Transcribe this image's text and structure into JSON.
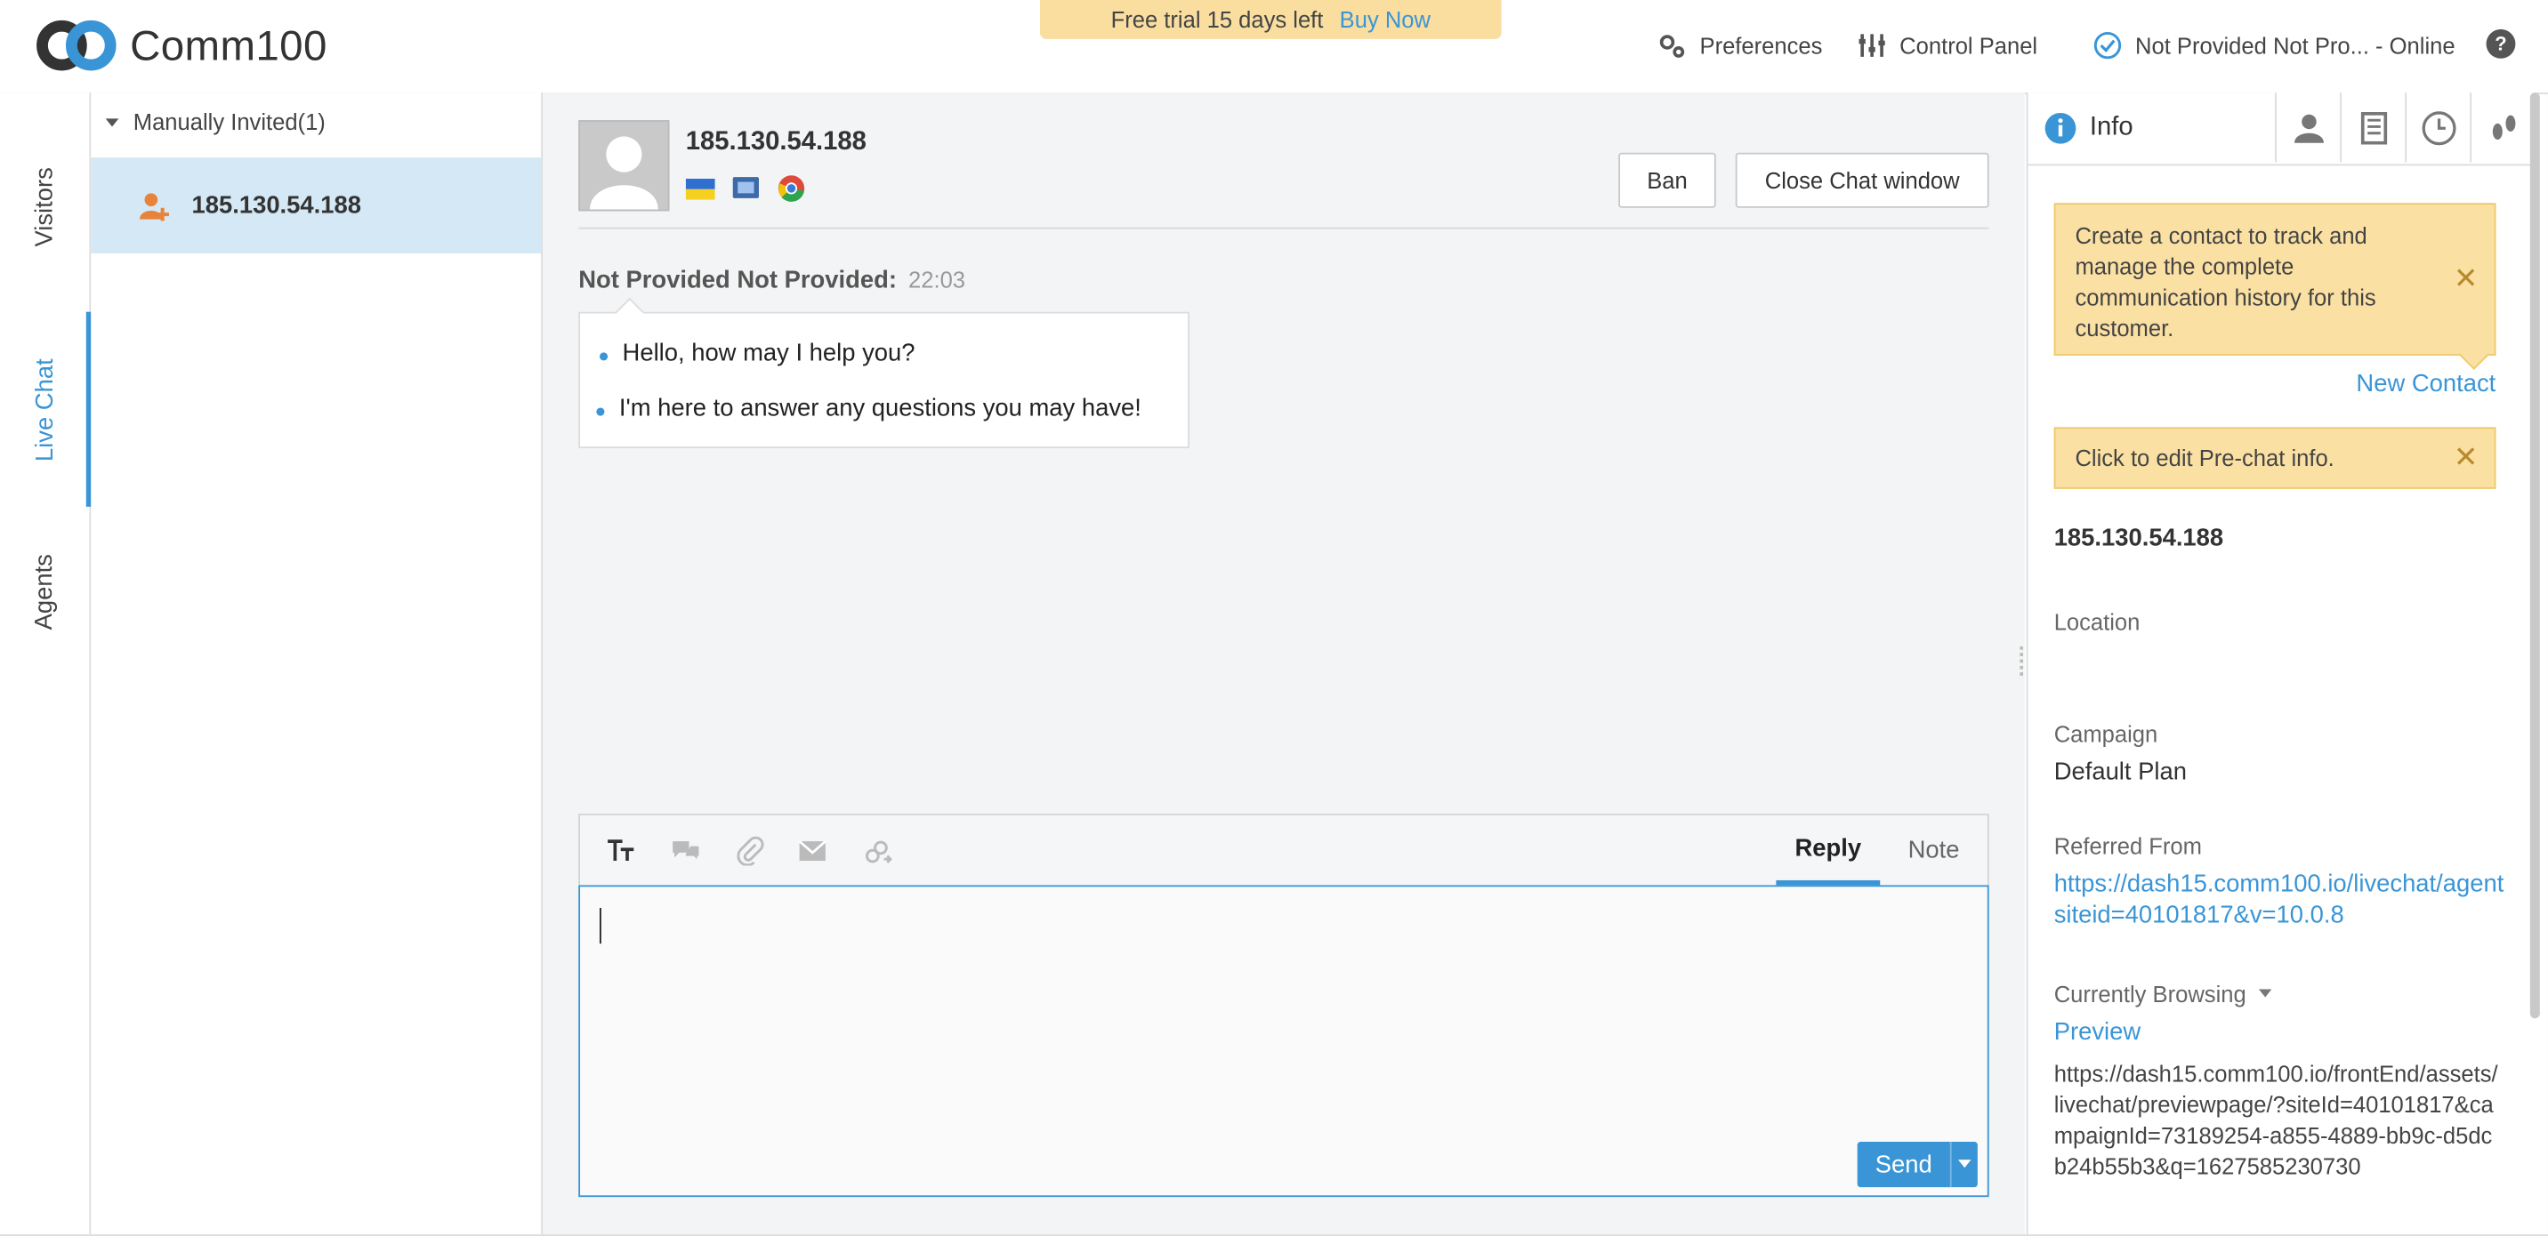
{
  "header": {
    "brand": "Comm100",
    "trial_text": "Free trial 15 days left",
    "buy_now": "Buy Now",
    "preferences": "Preferences",
    "control_panel": "Control Panel",
    "agent_status": "Not Provided Not Pro... - Online",
    "help": "?"
  },
  "rail": {
    "tabs": [
      {
        "label": "Visitors",
        "active": false
      },
      {
        "label": "Live Chat",
        "active": true
      },
      {
        "label": "Agents",
        "active": false
      }
    ]
  },
  "visitor_list": {
    "group_label": "Manually Invited(1)",
    "items": [
      {
        "ip": "185.130.54.188",
        "selected": true
      }
    ]
  },
  "chat": {
    "visitor_ip": "185.130.54.188",
    "ban_label": "Ban",
    "close_label": "Close Chat window",
    "message": {
      "sender": "Not Provided Not Provided:",
      "time": "22:03",
      "lines": [
        "Hello, how may I help you?",
        "I'm here to answer any questions you may have!"
      ]
    },
    "composer": {
      "reply_tab": "Reply",
      "note_tab": "Note",
      "send_label": "Send"
    }
  },
  "info_panel": {
    "tab_label": "Info",
    "contact_tip": "Create a contact to track and manage the complete communication history for this customer.",
    "new_contact": "New Contact",
    "prechat_tip": "Click to edit Pre-chat info.",
    "ip": "185.130.54.188",
    "location_label": "Location",
    "campaign_label": "Campaign",
    "campaign_value": "Default Plan",
    "referred_label": "Referred From",
    "referred_line1": "https://dash15.comm100.io/livechat/agent",
    "referred_line2": "siteid=40101817&v=10.0.8",
    "browsing_label": "Currently Browsing",
    "browsing_title": "Preview",
    "browsing_url": "https://dash15.comm100.io/frontEnd/assets/livechat/previewpage/?siteId=40101817&campaignId=73189254-a855-4889-bb9c-d5dcb24b55b3&q=1627585230730"
  },
  "colors": {
    "accent": "#3a95d6",
    "tip_bg": "#fbe0a3",
    "selected_row": "#d4e8f5",
    "chat_bg": "#f3f4f5"
  }
}
